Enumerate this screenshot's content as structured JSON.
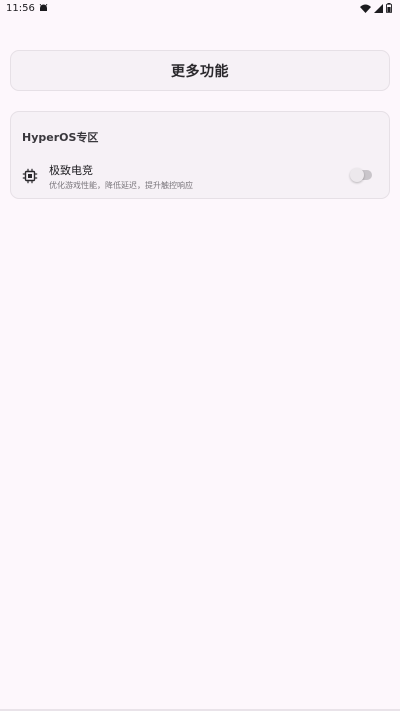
{
  "status_bar": {
    "time": "11:56",
    "notification_icon": "android-icon",
    "wifi_icon": "wifi-icon",
    "signal_icon": "signal-icon",
    "battery_icon": "battery-icon"
  },
  "header": {
    "title": "更多功能"
  },
  "section": {
    "title": "HyperOS专区",
    "items": [
      {
        "icon": "chip-icon",
        "title": "极致电竞",
        "description": "优化游戏性能，降低延迟，提升触控响应",
        "enabled": false
      }
    ]
  },
  "colors": {
    "background": "#fdf7fc",
    "card": "#f6f1f6",
    "toggle_off_track": "#c9c5ca"
  }
}
